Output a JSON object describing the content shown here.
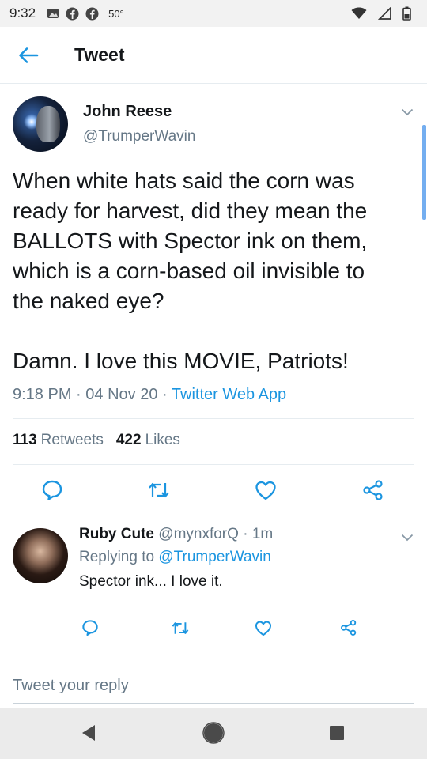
{
  "status_bar": {
    "time": "9:32",
    "temperature": "50°",
    "icons": [
      "gallery-icon",
      "facebook-icon",
      "facebook-icon",
      "wifi-icon",
      "signal-icon",
      "battery-icon"
    ]
  },
  "app_bar": {
    "title": "Tweet",
    "back_icon": "arrow-left-icon"
  },
  "tweet": {
    "author_name": "John Reese",
    "author_handle": "@TrumperWavin",
    "text": "When white hats said the corn was\nready for harvest, did they mean the\nBALLOTS with Spector ink on them,\nwhich is a corn-based oil invisible to\nthe naked eye?\n\nDamn. I love this MOVIE, Patriots!",
    "time": "9:18 PM",
    "date": "04 Nov 20",
    "source": "Twitter Web App",
    "separator": "·",
    "retweets_count": "113",
    "retweets_label": "Retweets",
    "likes_count": "422",
    "likes_label": "Likes",
    "actions": [
      "reply-icon",
      "retweet-icon",
      "like-icon",
      "share-icon"
    ]
  },
  "reply": {
    "author_name": "Ruby Cute",
    "author_handle": "@mynxforQ",
    "separator": "·",
    "age": "1m",
    "replying_prefix": "Replying to",
    "replying_to": "@TrumperWavin",
    "text": "Spector ink...  I love it."
  },
  "reply_box": {
    "placeholder": "Tweet your reply"
  },
  "nav_bar": {
    "buttons": [
      "back-triangle-icon",
      "home-circle-icon",
      "recents-square-icon"
    ]
  },
  "colors": {
    "link": "#1b95e0",
    "muted": "#657786",
    "text": "#14171a",
    "divider": "#e6ecf0"
  }
}
